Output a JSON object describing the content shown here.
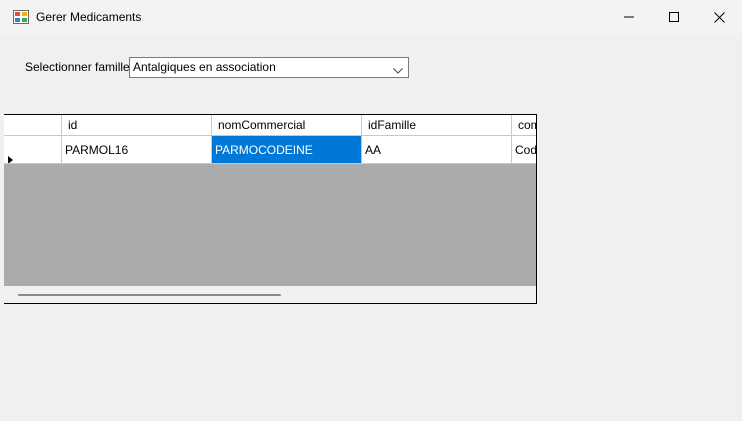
{
  "window": {
    "title": "Gerer Medicaments",
    "app_icon": "winforms-app-icon",
    "controls": [
      "minimize-icon",
      "maximize-icon",
      "close-icon"
    ]
  },
  "filter": {
    "label": "Selectionner familles",
    "selected_value": "Antalgiques en association"
  },
  "grid": {
    "columns": [
      "id",
      "nomCommercial",
      "idFamille",
      "com"
    ],
    "rows": [
      [
        "PARMOL16",
        "PARMOCODEINE",
        "AA",
        "Code"
      ]
    ],
    "selected_cell": {
      "row": 0,
      "column": "nomCommercial"
    }
  },
  "colors": {
    "selection": "#0078d7",
    "grid_background": "#ababab",
    "window_background": "#f0f0f0"
  }
}
